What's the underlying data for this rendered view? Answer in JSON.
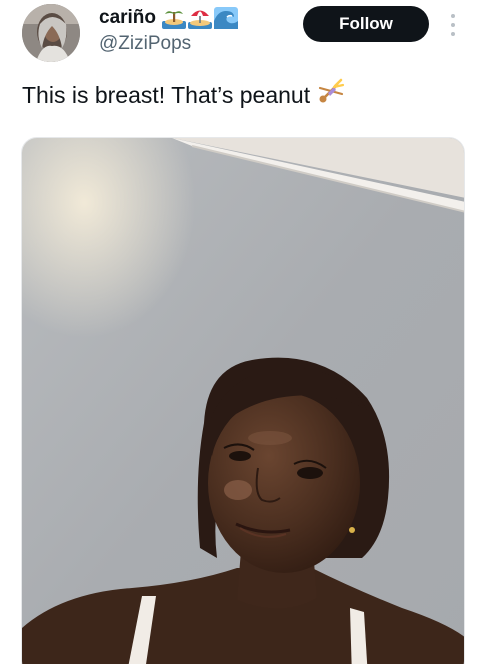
{
  "author": {
    "display_name": "cariño",
    "handle": "@ZiziPops",
    "name_emojis": [
      "island-emoji",
      "beach-umbrella-emoji",
      "wave-emoji"
    ]
  },
  "follow_button": {
    "label": "Follow"
  },
  "more_options": {
    "icon": "more-vertical-icon"
  },
  "tweet": {
    "text": "This is breast! That’s peanut",
    "emoji": "person-cartwheeling-emoji"
  },
  "media": {
    "type": "photo"
  },
  "colors": {
    "follow_bg": "#0f1419",
    "follow_text": "#ffffff",
    "handle": "#536471",
    "text": "#0f1419"
  }
}
